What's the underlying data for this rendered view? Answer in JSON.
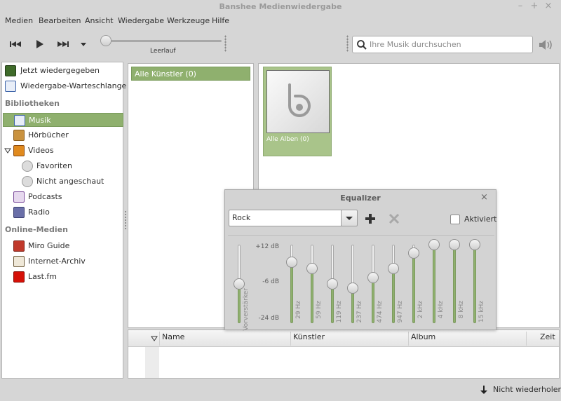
{
  "window": {
    "title": "Banshee Medienwiedergabe"
  },
  "menubar": {
    "items": [
      "Medien",
      "Bearbeiten",
      "Ansicht",
      "Wiedergabe",
      "Werkzeuge",
      "Hilfe"
    ]
  },
  "toolbar": {
    "status": "Leerlauf",
    "search_placeholder": "Ihre Musik durchsuchen"
  },
  "sidebar": {
    "top_items": [
      {
        "label": "Jetzt wiedergegeben",
        "icon": "now-playing-icon"
      },
      {
        "label": "Wiedergabe-Warteschlange",
        "icon": "play-queue-icon"
      }
    ],
    "libraries_heading": "Bibliotheken",
    "libraries": [
      {
        "label": "Musik",
        "icon": "music-icon",
        "selected": true
      },
      {
        "label": "Hörbücher",
        "icon": "audiobook-icon"
      },
      {
        "label": "Videos",
        "icon": "video-icon",
        "expanded": true
      },
      {
        "label": "Favoriten",
        "icon": "smart-playlist-icon",
        "child": true
      },
      {
        "label": "Nicht angeschaut",
        "icon": "smart-playlist-icon",
        "child": true
      },
      {
        "label": "Podcasts",
        "icon": "podcast-icon"
      },
      {
        "label": "Radio",
        "icon": "radio-icon"
      }
    ],
    "online_heading": "Online-Medien",
    "online": [
      {
        "label": "Miro Guide",
        "icon": "miro-icon"
      },
      {
        "label": "Internet-Archiv",
        "icon": "archive-icon"
      },
      {
        "label": "Last.fm",
        "icon": "lastfm-icon"
      }
    ]
  },
  "artists": {
    "all_label": "Alle Künstler (0)"
  },
  "albums": {
    "all_label": "Alle Alben (0)"
  },
  "tracks": {
    "columns": [
      "Name",
      "Künstler",
      "Album",
      "Zeit"
    ]
  },
  "status": {
    "repeat_label": "Nicht wiederholen"
  },
  "equalizer": {
    "title": "Equalizer",
    "preset": "Rock",
    "enabled_label": "Aktiviert",
    "enabled": false,
    "scale": [
      "+12 dB",
      "-6 dB",
      "-24 dB"
    ],
    "preamp_label": "Vorverstärker",
    "preamp_db": -6,
    "bands": [
      {
        "label": "29 Hz",
        "db": 4
      },
      {
        "label": "59 Hz",
        "db": 1
      },
      {
        "label": "119 Hz",
        "db": -6
      },
      {
        "label": "237 Hz",
        "db": -8
      },
      {
        "label": "474 Hz",
        "db": -3
      },
      {
        "label": "947 Hz",
        "db": 1
      },
      {
        "label": "2 kHz",
        "db": 8
      },
      {
        "label": "4 kHz",
        "db": 12
      },
      {
        "label": "8 kHz",
        "db": 12
      },
      {
        "label": "15 kHz",
        "db": 12
      }
    ]
  },
  "colors": {
    "accent": "#8fb06e",
    "background": "#d6d6d6"
  }
}
